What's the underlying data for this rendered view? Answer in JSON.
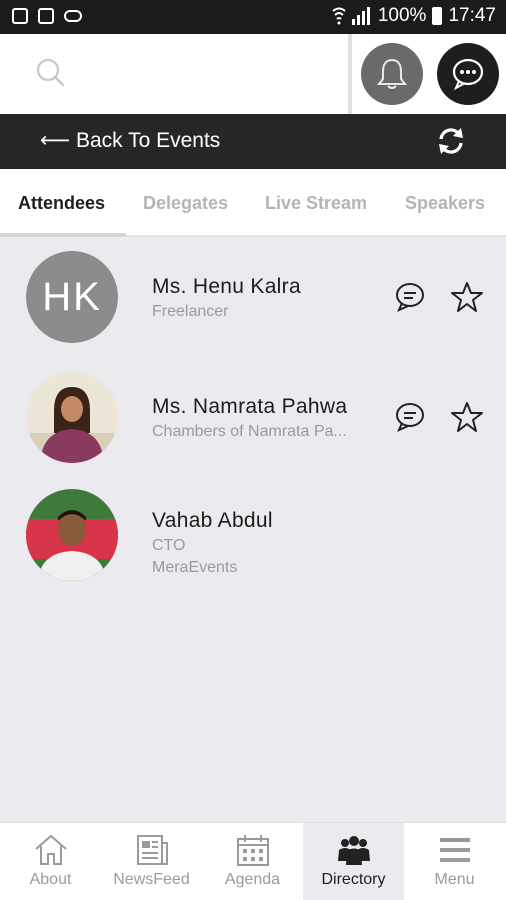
{
  "status_bar": {
    "battery": "100%",
    "time": "17:47"
  },
  "header": {
    "search_icon": "search-icon",
    "notification_icon": "bell-icon",
    "chat_icon": "chat-bubble-icon"
  },
  "backbar": {
    "back_label": "⟵ Back To Events",
    "refresh_icon": "refresh-icon"
  },
  "tabs": [
    {
      "label": "Attendees",
      "active": true
    },
    {
      "label": "Delegates",
      "active": false
    },
    {
      "label": "Live Stream",
      "active": false
    },
    {
      "label": "Speakers",
      "active": false
    }
  ],
  "attendees": [
    {
      "initials": "HK",
      "name": "Ms. Henu Kalra",
      "title": "Freelancer",
      "company": "",
      "has_actions": true
    },
    {
      "initials": "",
      "name": "Ms. Namrata Pahwa",
      "title": "Chambers of Namrata Pa...",
      "company": "",
      "has_actions": true
    },
    {
      "initials": "",
      "name": "Vahab Abdul",
      "title": "CTO",
      "company": "MeraEvents",
      "has_actions": false
    }
  ],
  "bottom_nav": [
    {
      "label": "About",
      "icon": "home-icon",
      "active": false
    },
    {
      "label": "NewsFeed",
      "icon": "newspaper-icon",
      "active": false
    },
    {
      "label": "Agenda",
      "icon": "calendar-icon",
      "active": false
    },
    {
      "label": "Directory",
      "icon": "people-icon",
      "active": true
    },
    {
      "label": "Menu",
      "icon": "hamburger-icon",
      "active": false
    }
  ],
  "colors": {
    "dark_bar": "#262626",
    "background": "#ebebef",
    "avatar_grey": "#8c8c8c"
  }
}
